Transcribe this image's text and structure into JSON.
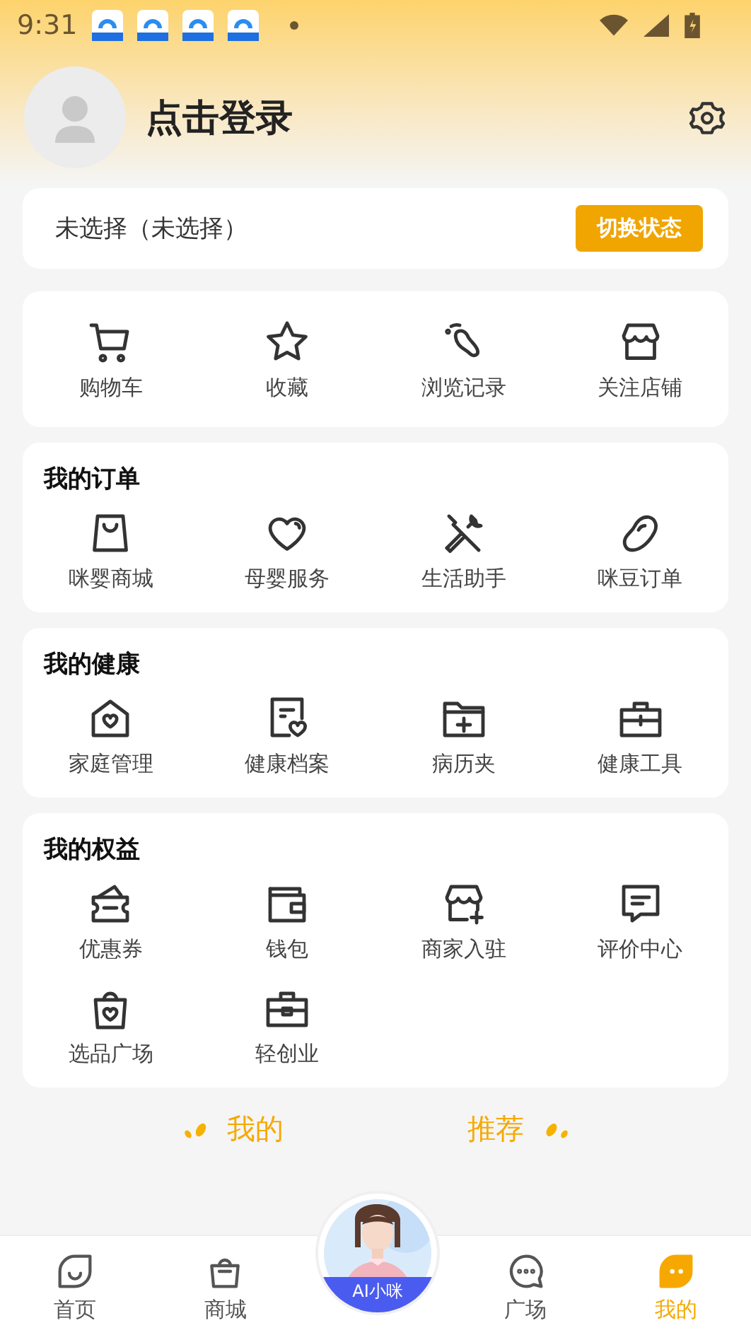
{
  "status_bar": {
    "time": "9:31"
  },
  "profile": {
    "name": "点击登录"
  },
  "status_card": {
    "text": "未选择（未选择）",
    "button": "切换状态"
  },
  "quick_links": [
    "购物车",
    "收藏",
    "浏览记录",
    "关注店铺"
  ],
  "sections": [
    {
      "title": "我的订单",
      "items": [
        "咪婴商城",
        "母婴服务",
        "生活助手",
        "咪豆订单"
      ]
    },
    {
      "title": "我的健康",
      "items": [
        "家庭管理",
        "健康档案",
        "病历夹",
        "健康工具"
      ]
    },
    {
      "title": "我的权益",
      "items": [
        "优惠券",
        "钱包",
        "商家入驻",
        "评价中心",
        "选品广场",
        "轻创业"
      ]
    }
  ],
  "recommend": {
    "left": "我的",
    "right": "推荐"
  },
  "assistant": {
    "label": "AI小咪"
  },
  "nav": [
    {
      "label": "首页",
      "selected": false
    },
    {
      "label": "商城",
      "selected": false
    },
    {
      "label": "广场",
      "selected": false
    },
    {
      "label": "我的",
      "selected": true
    }
  ]
}
